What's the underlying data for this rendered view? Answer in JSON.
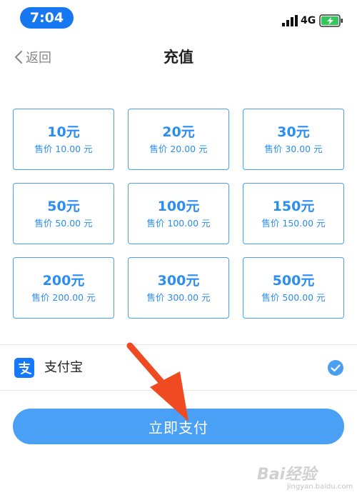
{
  "status_bar": {
    "time": "7:04",
    "network": "4G",
    "icons": {
      "signal": "signal-bars-icon",
      "battery": "battery-charging-icon"
    },
    "accent_color": "#1677f0",
    "battery_color": "#34c759"
  },
  "nav": {
    "back_label": "返回",
    "title": "充值",
    "icons": {
      "back": "chevron-left-icon"
    }
  },
  "amount_options": [
    {
      "value": "10元",
      "price": "售价 10.00 元"
    },
    {
      "value": "20元",
      "price": "售价 20.00 元"
    },
    {
      "value": "30元",
      "price": "售价 30.00 元"
    },
    {
      "value": "50元",
      "price": "售价 50.00 元"
    },
    {
      "value": "100元",
      "price": "售价 100.00 元"
    },
    {
      "value": "150元",
      "price": "售价 150.00 元"
    },
    {
      "value": "200元",
      "price": "售价 200.00 元"
    },
    {
      "value": "300元",
      "price": "售价 300.00 元"
    },
    {
      "value": "500元",
      "price": "售价 500.00 元"
    }
  ],
  "payment": {
    "method_label": "支付宝",
    "selected": true,
    "icons": {
      "method": "alipay-icon",
      "check": "check-circle-icon"
    },
    "brand_color": "#1677ff"
  },
  "pay_button": {
    "label": "立即支付",
    "color": "#4aa0f5"
  },
  "annotation": {
    "arrow_color": "#f04a22",
    "icon": "red-arrow-annotation"
  },
  "watermark": {
    "logo_text": "Bai经验",
    "url_text": "jingyan.baidu.com"
  }
}
